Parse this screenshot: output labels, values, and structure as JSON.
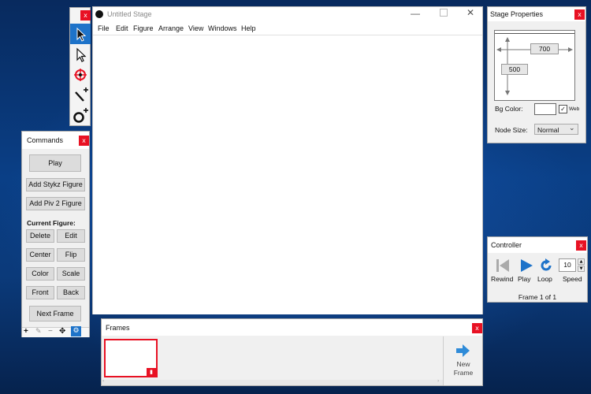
{
  "toolbox": {
    "close": "x",
    "tools": [
      "select-arrow-icon",
      "hollow-arrow-icon",
      "target-icon",
      "add-line-icon",
      "add-circle-icon"
    ]
  },
  "stage": {
    "title": "Untitled Stage",
    "menu": [
      "File",
      "Edit",
      "Figure",
      "Arrange",
      "View",
      "Windows",
      "Help"
    ]
  },
  "commands": {
    "title": "Commands",
    "close": "x",
    "play": "Play",
    "add_stykz": "Add Stykz Figure",
    "add_piv": "Add Piv 2 Figure",
    "current_figure": "Current Figure:",
    "buttons": [
      "Delete",
      "Edit",
      "Center",
      "Flip",
      "Color",
      "Scale",
      "Front",
      "Back"
    ],
    "next_frame": "Next Frame",
    "bottom_icons": [
      "+",
      "✎",
      "−",
      "✥",
      "⚙"
    ]
  },
  "stage_properties": {
    "title": "Stage Properties",
    "close": "x",
    "width": "700",
    "height": "500",
    "bg_color_label": "Bg Color:",
    "web_label": "Web",
    "web_checked": true,
    "bg_color": "#ffffff",
    "node_size_label": "Node Size:",
    "node_size_value": "Normal"
  },
  "controller": {
    "title": "Controller",
    "close": "x",
    "rewind": "Rewind",
    "play": "Play",
    "loop": "Loop",
    "speed_label": "Speed",
    "speed_value": "10",
    "frame_status": "Frame 1 of 1"
  },
  "frames": {
    "title": "Frames",
    "close": "x",
    "new_frame_line1": "New",
    "new_frame_line2": "Frame"
  },
  "colors": {
    "close_red": "#e81123",
    "accent_blue": "#1e73c9",
    "frame_border_red": "#e81123"
  }
}
